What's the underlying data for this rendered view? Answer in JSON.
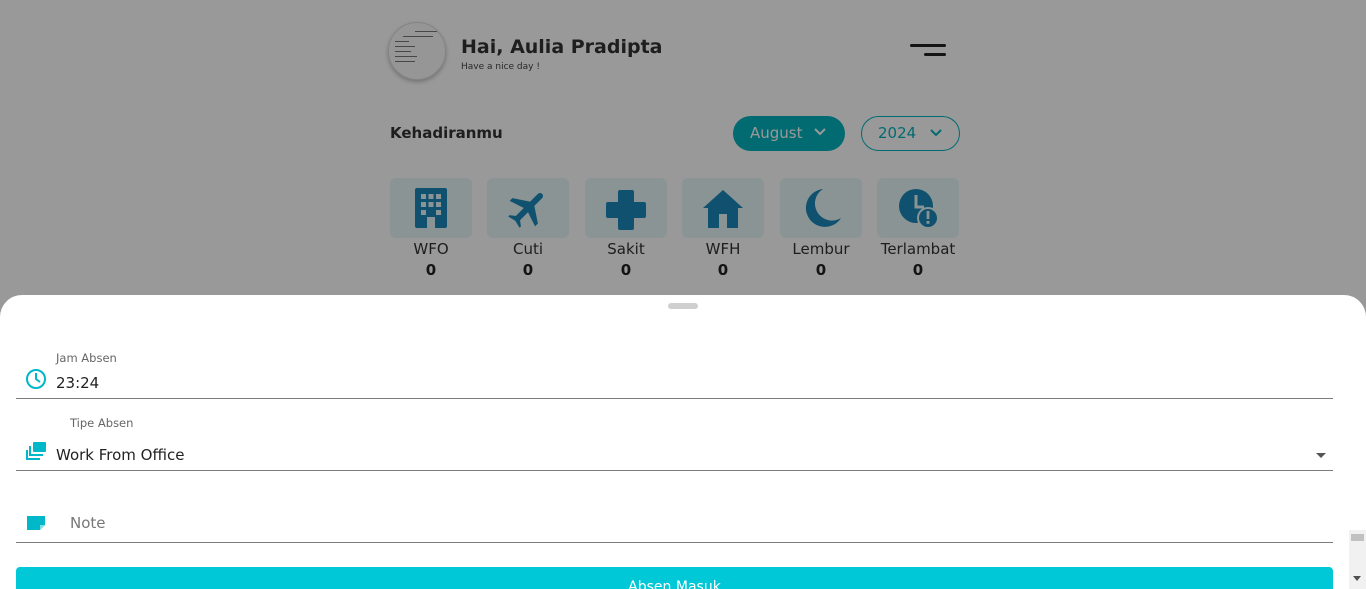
{
  "header": {
    "greeting": "Hai, Aulia Pradipta",
    "subtitle": "Have a nice day !"
  },
  "attendance": {
    "title": "Kehadiranmu",
    "month": "August",
    "year": "2024",
    "stats": [
      {
        "label": "WFO",
        "count": "0",
        "icon": "office-building-icon"
      },
      {
        "label": "Cuti",
        "count": "0",
        "icon": "airplane-icon"
      },
      {
        "label": "Sakit",
        "count": "0",
        "icon": "medical-cross-icon"
      },
      {
        "label": "WFH",
        "count": "0",
        "icon": "house-icon"
      },
      {
        "label": "Lembur",
        "count": "0",
        "icon": "moon-icon"
      },
      {
        "label": "Terlambat",
        "count": "0",
        "icon": "clock-alert-icon"
      }
    ]
  },
  "form": {
    "time_label": "Jam Absen",
    "time_value": "23:24",
    "type_label": "Tipe Absen",
    "type_value": "Work From Office",
    "note_placeholder": "Note",
    "submit_label": "Absen Masuk"
  },
  "colors": {
    "accent": "#02b3bd",
    "button": "#00c8d6",
    "icon_blue": "#1a87b8"
  }
}
